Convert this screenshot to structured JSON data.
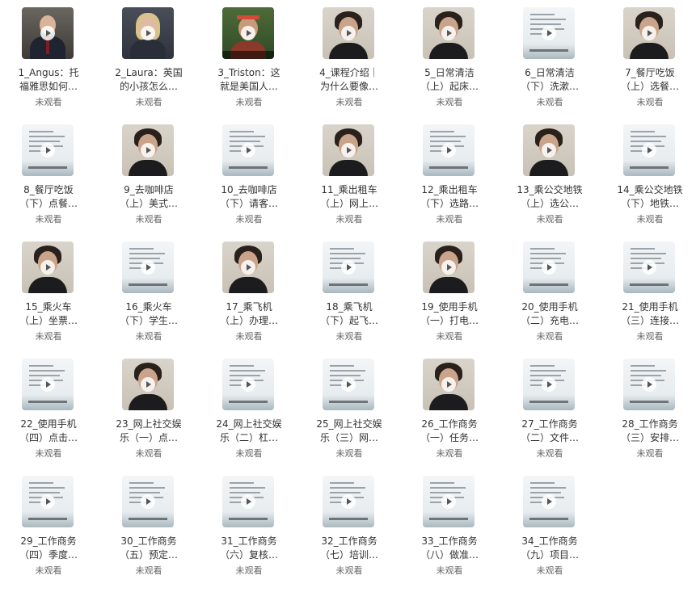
{
  "status_text": "未观看",
  "items": [
    {
      "l1": "1_Angus：托",
      "l2": "福雅思如何…",
      "thumb": "speaker1"
    },
    {
      "l1": "2_Laura：英国",
      "l2": "的小孩怎么…",
      "thumb": "speaker2"
    },
    {
      "l1": "3_Triston：这",
      "l2": "就是美国人…",
      "thumb": "speaker3"
    },
    {
      "l1": "4_课程介绍｜",
      "l2": "为什么要像…",
      "thumb": "person"
    },
    {
      "l1": "5_日常清洁",
      "l2": "（上）起床…",
      "thumb": "person"
    },
    {
      "l1": "6_日常清洁",
      "l2": "（下）洗漱…",
      "thumb": "slide"
    },
    {
      "l1": "7_餐厅吃饭",
      "l2": "（上）选餐…",
      "thumb": "person"
    },
    {
      "l1": "8_餐厅吃饭",
      "l2": "（下）点餐…",
      "thumb": "slide"
    },
    {
      "l1": "9_去咖啡店",
      "l2": "（上）美式…",
      "thumb": "person"
    },
    {
      "l1": "10_去咖啡店",
      "l2": "（下）请客…",
      "thumb": "slide"
    },
    {
      "l1": "11_乘出租车",
      "l2": "（上）网上…",
      "thumb": "person"
    },
    {
      "l1": "12_乘出租车",
      "l2": "（下）选路…",
      "thumb": "slide"
    },
    {
      "l1": "13_乘公交地铁",
      "l2": "（上）选公…",
      "thumb": "person"
    },
    {
      "l1": "14_乘公交地铁",
      "l2": "（下）地铁…",
      "thumb": "slide"
    },
    {
      "l1": "15_乘火车",
      "l2": "（上）坐票…",
      "thumb": "person"
    },
    {
      "l1": "16_乘火车",
      "l2": "（下）学生…",
      "thumb": "slide"
    },
    {
      "l1": "17_乘飞机",
      "l2": "（上）办理…",
      "thumb": "person"
    },
    {
      "l1": "18_乘飞机",
      "l2": "（下）起飞…",
      "thumb": "slide"
    },
    {
      "l1": "19_使用手机",
      "l2": "（一）打电…",
      "thumb": "person"
    },
    {
      "l1": "20_使用手机",
      "l2": "（二）充电…",
      "thumb": "slide"
    },
    {
      "l1": "21_使用手机",
      "l2": "（三）连接…",
      "thumb": "slide"
    },
    {
      "l1": "22_使用手机",
      "l2": "（四）点击…",
      "thumb": "slide"
    },
    {
      "l1": "23_网上社交娱",
      "l2": "乐（一）点…",
      "thumb": "person"
    },
    {
      "l1": "24_网上社交娱",
      "l2": "乐（二）杠…",
      "thumb": "slide"
    },
    {
      "l1": "25_网上社交娱",
      "l2": "乐（三）网…",
      "thumb": "slide"
    },
    {
      "l1": "26_工作商务",
      "l2": "（一）任务…",
      "thumb": "person"
    },
    {
      "l1": "27_工作商务",
      "l2": "（二）文件…",
      "thumb": "slide"
    },
    {
      "l1": "28_工作商务",
      "l2": "（三）安排…",
      "thumb": "slide"
    },
    {
      "l1": "29_工作商务",
      "l2": "（四）季度…",
      "thumb": "slide"
    },
    {
      "l1": "30_工作商务",
      "l2": "（五）预定…",
      "thumb": "slide"
    },
    {
      "l1": "31_工作商务",
      "l2": "（六）复核…",
      "thumb": "slide"
    },
    {
      "l1": "32_工作商务",
      "l2": "（七）培训…",
      "thumb": "slide"
    },
    {
      "l1": "33_工作商务",
      "l2": "（八）做准…",
      "thumb": "slide"
    },
    {
      "l1": "34_工作商务",
      "l2": "（九）项目…",
      "thumb": "slide"
    }
  ]
}
